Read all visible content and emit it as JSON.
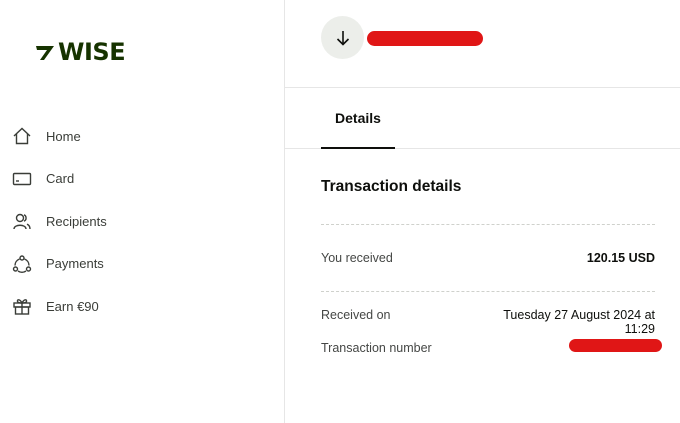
{
  "brand": {
    "logo_text": "WISE",
    "color": "#163300"
  },
  "sidebar": {
    "items": [
      {
        "label": "Home",
        "icon": "home-icon"
      },
      {
        "label": "Card",
        "icon": "card-icon"
      },
      {
        "label": "Recipients",
        "icon": "recipients-icon"
      },
      {
        "label": "Payments",
        "icon": "payments-icon"
      },
      {
        "label": "Earn €90",
        "icon": "gift-icon"
      }
    ]
  },
  "header": {
    "icon": "arrow-down-icon",
    "redaction_color": "#e01616"
  },
  "tabs": [
    {
      "label": "Details",
      "active": true
    }
  ],
  "details": {
    "title": "Transaction details",
    "received_label": "You received",
    "received_value": "120.15 USD",
    "received_on_label": "Received on",
    "received_on_value_line1": "Tuesday 27 August 2024 at",
    "received_on_value_line2": "11:29",
    "transaction_number_label": "Transaction number"
  }
}
